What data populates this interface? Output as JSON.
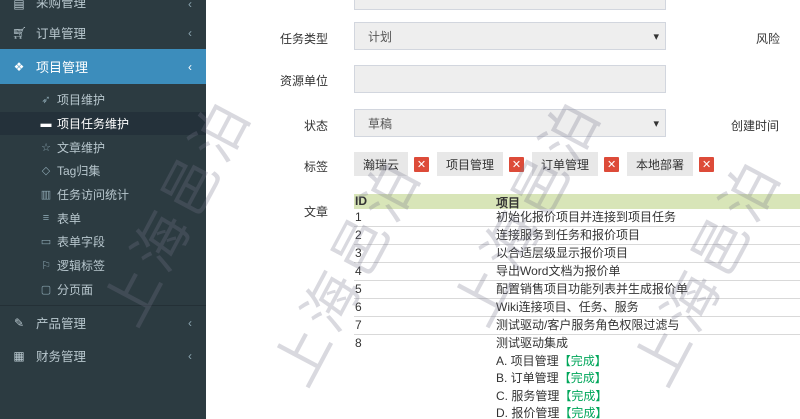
{
  "sidebar": {
    "top_partial": {
      "icon": "list-icon",
      "label": "采购管理"
    },
    "items": [
      {
        "icon": "cart-icon",
        "label": "订单管理"
      },
      {
        "icon": "cubes-icon",
        "label": "项目管理"
      }
    ],
    "sub_items": [
      {
        "icon": "rocket-icon",
        "label": "项目维护"
      },
      {
        "icon": "card-icon",
        "label": "项目任务维护"
      },
      {
        "icon": "star-icon",
        "label": "文章维护"
      },
      {
        "icon": "tag-icon",
        "label": "Tag归集"
      },
      {
        "icon": "bar-chart-icon",
        "label": "任务访问统计"
      },
      {
        "icon": "list-icon",
        "label": "表单"
      },
      {
        "icon": "credit-card-icon",
        "label": "表单字段"
      },
      {
        "icon": "flag-icon",
        "label": "逻辑标签"
      },
      {
        "icon": "folder-icon",
        "label": "分页面"
      }
    ],
    "bottom_items": [
      {
        "icon": "edit-icon",
        "label": "产品管理"
      },
      {
        "icon": "finance-icon",
        "label": "财务管理"
      }
    ]
  },
  "form": {
    "task_type_label": "任务类型",
    "task_type_value": "计划",
    "resource_label": "资源单位",
    "resource_value": "",
    "status_label": "状态",
    "status_value": "草稿",
    "tags_label": "标签",
    "article_label": "文章",
    "risk_label": "风险",
    "created_label": "创建时间"
  },
  "tags": [
    "瀚瑞云",
    "项目管理",
    "订单管理",
    "本地部署"
  ],
  "article_table": {
    "headers": [
      "ID",
      "项目"
    ],
    "rows": [
      {
        "id": "1",
        "text": "初始化报价项目并连接到项目任务"
      },
      {
        "id": "2",
        "text": "连接服务到任务和报价项目"
      },
      {
        "id": "3",
        "text": "以合适层级显示报价项目"
      },
      {
        "id": "4",
        "text": "导出Word文档为报价单"
      },
      {
        "id": "5",
        "text": "配置销售项目功能列表并生成报价单"
      },
      {
        "id": "6",
        "text": "Wiki连接项目、任务、服务"
      },
      {
        "id": "7",
        "text": "测试驱动/客户服务角色权限过滤与"
      },
      {
        "id": "8",
        "text": "测试驱动集成"
      }
    ],
    "sub_lines": [
      {
        "text": "A. 项目管理",
        "status": "【完成】"
      },
      {
        "text": "B. 订单管理",
        "status": "【完成】"
      },
      {
        "text": "C. 服务管理",
        "status": "【完成】"
      },
      {
        "text": "D. 报价管理",
        "status": "【完成】"
      }
    ]
  },
  "watermark": "上海邑泊",
  "colors": {
    "sidebar_bg": "#2c3b41",
    "active_bg": "#3c8dbc",
    "delete_red": "#dd4b39",
    "table_head": "#d8e5b8",
    "done_green": "#00a65a"
  }
}
